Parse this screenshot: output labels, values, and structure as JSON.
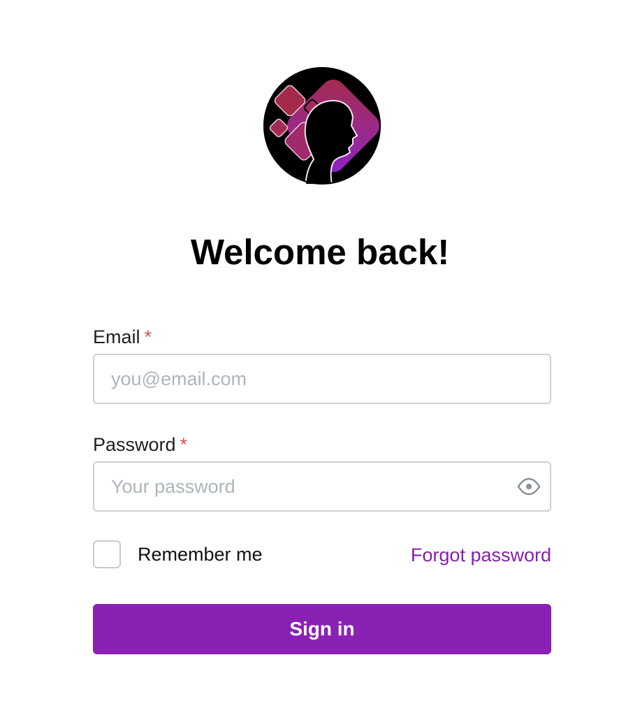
{
  "page": {
    "title": "Welcome back!",
    "accent_color": "#8a21b5",
    "link_color": "#861fae",
    "required_color": "#d9534f"
  },
  "logo": {
    "icon": "head-with-squares-logo"
  },
  "form": {
    "email": {
      "label": "Email",
      "required_mark": "*",
      "placeholder": "you@email.com",
      "value": ""
    },
    "password": {
      "label": "Password",
      "required_mark": "*",
      "placeholder": "Your password",
      "value": "",
      "toggle_icon": "eye-icon"
    },
    "remember": {
      "label": "Remember me",
      "checked": false
    },
    "forgot_link": "Forgot password",
    "submit_label": "Sign in"
  }
}
